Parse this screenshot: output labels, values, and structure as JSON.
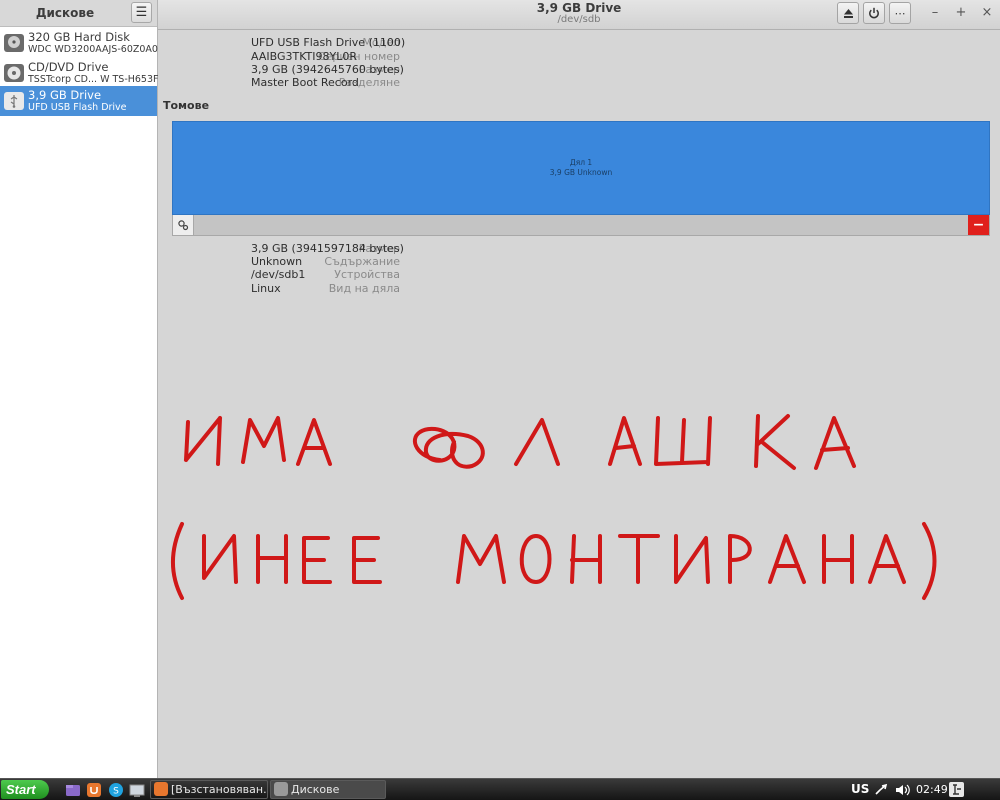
{
  "sidebar": {
    "title": "Дискове",
    "drives": [
      {
        "name": "320 GB Hard Disk",
        "model": "WDC WD3200AAJS-60Z0A0",
        "icon": "hard-disk-icon"
      },
      {
        "name": "CD/DVD Drive",
        "model": "TSSTcorp CD...    W TS-H653F",
        "icon": "optical-disc-icon"
      },
      {
        "name": "3,9 GB Drive",
        "model": "UFD USB Flash Drive",
        "icon": "usb-drive-icon",
        "selected": true
      }
    ]
  },
  "header": {
    "title": "3,9 GB Drive",
    "subtitle": "/dev/sdb"
  },
  "drive_info": [
    {
      "label": "Модел",
      "value": "UFD USB Flash Drive (1100)"
    },
    {
      "label": "Сериен номер",
      "value": "AAIBG3TKTI98YL0R"
    },
    {
      "label": "Размер",
      "value": "3,9 GB (3942645760 bytes)"
    },
    {
      "label": "Разделяне",
      "value": "Master Boot Record"
    }
  ],
  "volumes": {
    "title": "Томове",
    "partition_label": "Дял 1",
    "partition_size": "3,9 GB Unknown"
  },
  "partition_info": [
    {
      "label": "Размер",
      "value": "3,9 GB (3941597184 bytes)"
    },
    {
      "label": "Съдържание",
      "value": "Unknown"
    },
    {
      "label": "Устройства",
      "value": "/dev/sdb1"
    },
    {
      "label": "Вид на дяла",
      "value": "Linux"
    }
  ],
  "annotation": {
    "line1": "ИМА ФЛАШКА",
    "line2": "(И НЕ Е МОНТИРАНА)",
    "color": "#d01818"
  },
  "taskbar": {
    "start_label": "Start",
    "tasks": [
      "[Възстановяван...",
      "Дискове"
    ],
    "keyboard_layout": "US",
    "clock": "02:49"
  },
  "colors": {
    "selection": "#4a90d9",
    "volume": "#3a87dc",
    "delete": "#e0201c"
  }
}
